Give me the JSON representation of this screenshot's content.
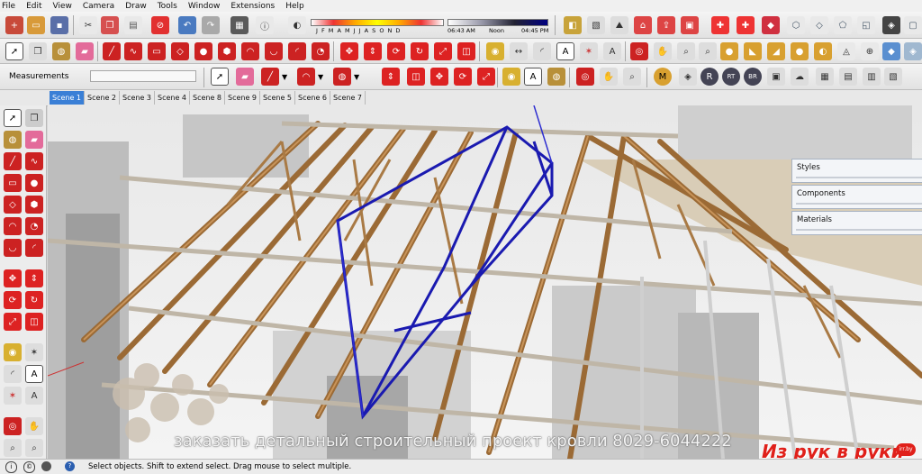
{
  "menu": [
    "File",
    "Edit",
    "View",
    "Camera",
    "Draw",
    "Tools",
    "Window",
    "Extensions",
    "Help"
  ],
  "shadow": {
    "months": "J F M A M J J A S O N D",
    "time_start": "06:43 AM",
    "time_mid": "Noon",
    "time_end": "04:45 PM"
  },
  "measurements": {
    "label": "Measurements",
    "value": ""
  },
  "scenes": [
    "Scene 1",
    "Scene 2",
    "Scene 3",
    "Scene 4",
    "Scene 8",
    "Scene 9",
    "Scene 5",
    "Scene 6",
    "Scene 7"
  ],
  "panels": [
    "Styles",
    "Components",
    "Materials"
  ],
  "overlay": {
    "caption": "заказать детальный строительный проект кровли 8029-6044222",
    "watermark": "Из рук в руки",
    "watermark_badge": "irr.by"
  },
  "status": {
    "hint": "Select objects. Shift to extend select. Drag mouse to select multiple."
  },
  "colors": {
    "selection": "#1a1ab0",
    "wood": "#b07a3c",
    "watermark": "#e0201a"
  }
}
